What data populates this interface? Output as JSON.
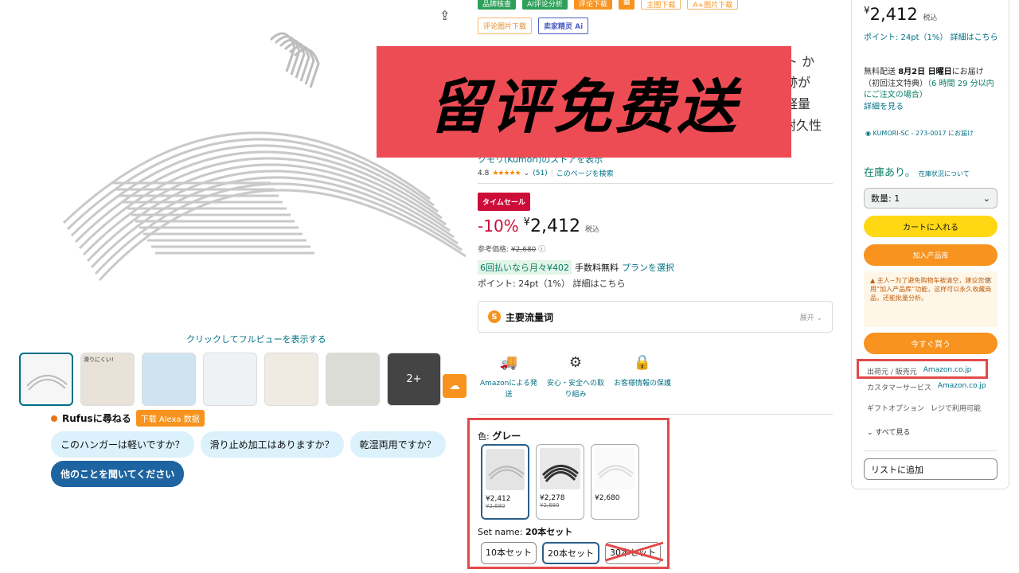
{
  "gallery": {
    "hint": "クリックしてフルビューを表示する",
    "more_label": "2+",
    "thumbs": [
      {
        "caption": ""
      },
      {
        "caption": "滑りにくい!"
      },
      {
        "caption": ""
      },
      {
        "caption": ""
      },
      {
        "caption": ""
      },
      {
        "caption": ""
      }
    ]
  },
  "rufus": {
    "label": "Rufusに尋ねる",
    "alexa_button": "下载 Alexa 数据",
    "chips": [
      "このハンガーは軽いですか？",
      "滑り止め加工はありますか？",
      "乾湿両用ですか？"
    ],
    "ask_button": "他のことを聞いてください"
  },
  "toolbar": {
    "row1": [
      "品牌核查",
      "AI评论分析",
      "评论下载",
      "▦",
      "主图下载",
      "A+图片下载"
    ],
    "row2": [
      "评论图片下载",
      "卖家精灵 Ai"
    ]
  },
  "overlay": {
    "text": "留评免费送"
  },
  "title_fragments": [
    "ト か",
    "跡が",
    "軽量",
    "耐久性"
  ],
  "store": "クモリ(Kumori)のストアを表示",
  "rating": {
    "value": "4.8",
    "stars": "★★★★★",
    "count": "(51)",
    "search_page": "このページを検索"
  },
  "deal": {
    "badge": "タイムセール",
    "discount": "-10%",
    "currency": "¥",
    "price": "2,412",
    "tax": "税込",
    "ref_label": "参考価格:",
    "ref_price": "¥2,680",
    "installment_hl": "6回払いなら月々¥402",
    "installment_fee": "手数料無料",
    "installment_link": "プランを選択",
    "points": "ポイント: 24pt（1%） 詳細はこちら"
  },
  "keywords": {
    "title": "主要流量词",
    "expand": "展开"
  },
  "features": [
    {
      "icon": "🚚",
      "label": "Amazonによる発送"
    },
    {
      "icon": "⚙",
      "label": "安心・安全への取り組み"
    },
    {
      "icon": "🔒",
      "label": "お客様情報の保護"
    }
  ],
  "variants": {
    "color_label": "色:",
    "color_value": "グレー",
    "swatches": [
      {
        "price": "¥2,412",
        "ref": "¥2,680",
        "tone": "#d5d5d5"
      },
      {
        "price": "¥2,278",
        "ref": "¥2,680",
        "tone": "#4a4a4a"
      },
      {
        "price": "¥2,680",
        "ref": "",
        "tone": "#f4f4f4"
      }
    ],
    "set_label": "Set name:",
    "set_value": "20本セット",
    "sizes": [
      "10本セット",
      "20本セット",
      "30本セット"
    ]
  },
  "buybox": {
    "currency": "¥",
    "price": "2,412",
    "tax": "税込",
    "points": "ポイント: 24pt（1%） 詳細はこちら",
    "delivery_pre": "無料配送",
    "delivery_date": "8月2日 日曜日",
    "delivery_mid": "にお届け（初回注文特典）",
    "delivery_time": "（6 時間 29 分以内にご注文の場合）",
    "delivery_link": "詳細を見る",
    "location": "KUMORI-SC - 273-0017 にお届け",
    "stock": "在庫あり。",
    "stock_link": "在庫状況について",
    "qty_label": "数量: 1",
    "cart": "カートに入れる",
    "add_lib": "加入产品库",
    "notice": "主人~为了避免购物车被清空，建议您使用“加入产品库”功能，这样可以永久收藏商品，还能批量分析。",
    "buy_now": "今すぐ買う",
    "seller_rows": [
      {
        "k": "出荷元 / 販売元",
        "v": "Amazon.co.jp"
      },
      {
        "k": "カスタマーサービス",
        "v": "Amazon.co.jp"
      },
      {
        "k": "ギフトオプション",
        "v": "レジで利用可能"
      }
    ],
    "see_all": "すべて見る",
    "wishlist": "リストに追加"
  }
}
